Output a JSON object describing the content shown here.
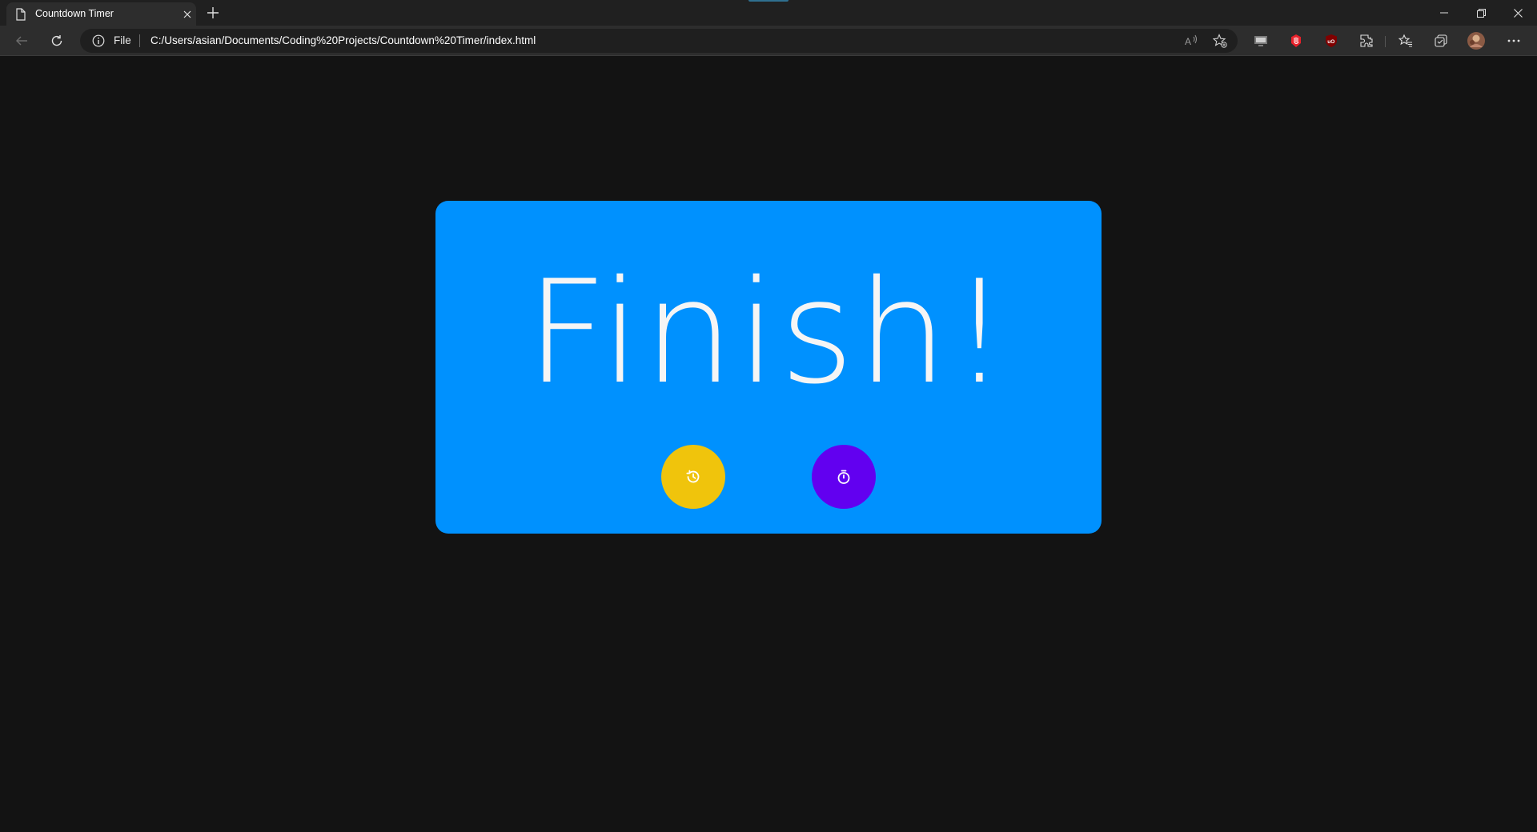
{
  "browser": {
    "tab": {
      "title": "Countdown Timer"
    },
    "address_bar": {
      "scheme_label": "File",
      "url": "C:/Users/asian/Documents/Coding%20Projects/Countdown%20Timer/index.html"
    }
  },
  "page": {
    "card": {
      "message": "Finish!",
      "background_color": "#0091fe",
      "reset_button": {
        "icon": "history-icon",
        "color": "#f0c40c"
      },
      "start_button": {
        "icon": "stopwatch-icon",
        "color": "#6200f0"
      }
    }
  }
}
